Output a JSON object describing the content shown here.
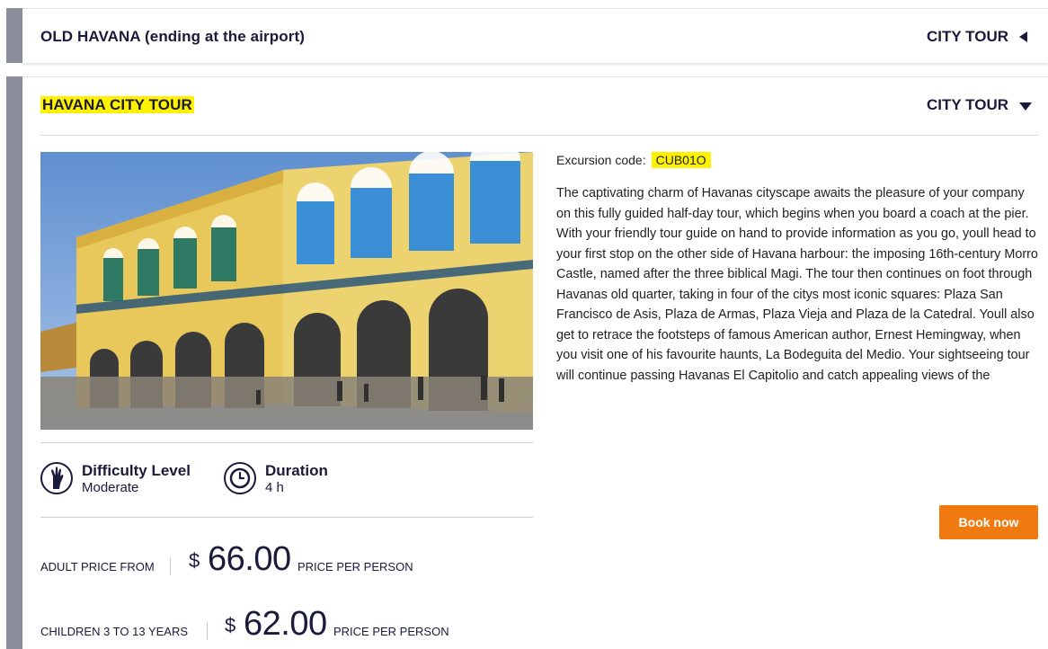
{
  "collapsed_tour": {
    "title": "OLD HAVANA (ending at the airport)",
    "type": "CITY TOUR",
    "toggle_icon": "triangle-left-icon"
  },
  "open_tour": {
    "title": "HAVANA CITY TOUR",
    "type": "CITY TOUR",
    "toggle_icon": "triangle-down-icon",
    "photo_icon": "havana-plaza-photo",
    "difficulty": {
      "label": "Difficulty Level",
      "value": "Moderate",
      "icon": "hand-icon"
    },
    "duration": {
      "label": "Duration",
      "value": "4 h",
      "icon": "clock-icon"
    },
    "prices": [
      {
        "label": "ADULT PRICE FROM",
        "currency": "$",
        "amount": "66.00",
        "unit": "PRICE PER PERSON"
      },
      {
        "label": "CHILDREN 3 TO 13 YEARS",
        "currency": "$",
        "amount": "62.00",
        "unit": "PRICE PER PERSON"
      }
    ],
    "code_label": "Excursion code:",
    "code_value": "CUB01O",
    "description": "The captivating charm of Havanas cityscape awaits the pleasure of your company on this fully guided half-day tour, which begins when you board a coach at the pier. With your friendly tour guide on hand to provide information as you go, youll head to your first stop on the other side of Havana harbour: the imposing 16th-century Morro Castle, named after the three biblical Magi. The tour then continues on foot through Havanas old quarter, taking in four of the citys most iconic squares: Plaza San Francisco de Asis, Plaza de Armas, Plaza Vieja and Plaza de la Catedral. Youll also get to retrace the footsteps of famous American author, Ernest Hemingway, when you visit one of his favourite haunts, La Bodeguita del Medio. Your sightseeing tour will continue passing Havanas El Capitolio and catch appealing views of the",
    "book_label": "Book now"
  },
  "colors": {
    "side_bar": "#8b8d9a",
    "title_text": "#1a1a3a",
    "highlight": "#fff200",
    "book_button": "#f07a10"
  }
}
